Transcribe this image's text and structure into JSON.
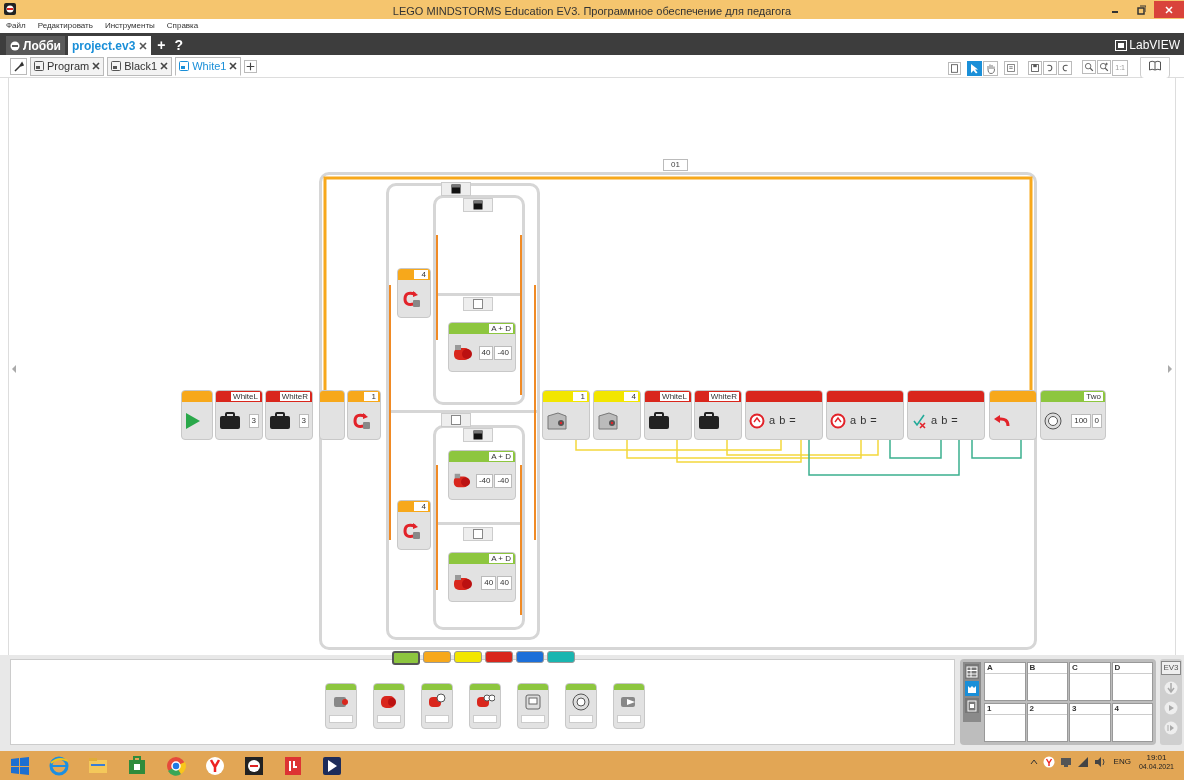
{
  "window": {
    "title": "LEGO MINDSTORMS Education EV3. Программное обеспечение для педагога"
  },
  "menu": [
    "Файл",
    "Редактировать",
    "Инструменты",
    "Справка"
  ],
  "project_tabs": [
    {
      "label": "Лобби",
      "selected": false
    },
    {
      "label": "project.ev3",
      "selected": true
    }
  ],
  "project_actions": [
    "+",
    "?"
  ],
  "brand": "LabVIEW",
  "program_tabs": [
    {
      "label": "Program",
      "selected": false
    },
    {
      "label": "Black1",
      "selected": false
    },
    {
      "label": "White1",
      "selected": true
    }
  ],
  "tools": [
    {
      "kind": "pointer",
      "selected": true
    },
    {
      "kind": "pan",
      "selected": false
    }
  ],
  "zoom_reset": "1:1",
  "loop": {
    "label": "01"
  },
  "main_blocks": [
    {
      "kind": "start",
      "color": "#f7a81b"
    },
    {
      "kind": "variable",
      "color": "#d9261c",
      "header": "WhiteL",
      "params": [
        "3"
      ]
    },
    {
      "kind": "variable",
      "color": "#d9261c",
      "header": "WhiteR",
      "params": [
        "3"
      ]
    },
    {
      "kind": "loop",
      "color": "#f7a81b"
    },
    {
      "kind": "switch",
      "color": "#f7a81b",
      "header": "1"
    },
    {
      "kind": "sensor",
      "color": "#f2e600",
      "header": "1"
    },
    {
      "kind": "sensor",
      "color": "#f2e600",
      "header": "4"
    },
    {
      "kind": "variable",
      "color": "#d9261c",
      "header": "WhiteL"
    },
    {
      "kind": "variable",
      "color": "#d9261c",
      "header": "WhiteR"
    },
    {
      "kind": "compare",
      "color": "#d9261c",
      "labels": [
        "a",
        "b",
        "="
      ]
    },
    {
      "kind": "compare",
      "color": "#d9261c",
      "labels": [
        "a",
        "b",
        "="
      ]
    },
    {
      "kind": "math",
      "color": "#d9261c",
      "labels": [
        "a",
        "b",
        "="
      ]
    },
    {
      "kind": "interrupt",
      "color": "#f7a81b"
    },
    {
      "kind": "sound",
      "color": "#8dc63f",
      "header": "Two",
      "params": [
        "100",
        "0"
      ]
    }
  ],
  "inner_blocks": [
    {
      "kind": "switch",
      "color": "#f7a81b",
      "header": "4"
    },
    {
      "kind": "motor",
      "color": "#8dc63f",
      "header": "A + D",
      "params": [
        "40",
        "-40"
      ]
    },
    {
      "kind": "switch",
      "color": "#f7a81b",
      "header": "4"
    },
    {
      "kind": "motor",
      "color": "#8dc63f",
      "header": "A + D",
      "params": [
        "-40",
        "-40"
      ]
    },
    {
      "kind": "motor",
      "color": "#8dc63f",
      "header": "A + D",
      "params": [
        "40",
        "40"
      ]
    }
  ],
  "palette_tabs": [
    {
      "color": "#8dc63f",
      "selected": true
    },
    {
      "color": "#f7a81b",
      "selected": false
    },
    {
      "color": "#f2e600",
      "selected": false
    },
    {
      "color": "#d9261c",
      "selected": false
    },
    {
      "color": "#1c6fd9",
      "selected": false
    },
    {
      "color": "#19b5b0",
      "selected": false
    }
  ],
  "palette_blocks": [
    {
      "kind": "medium-motor"
    },
    {
      "kind": "large-motor"
    },
    {
      "kind": "steering"
    },
    {
      "kind": "tank"
    },
    {
      "kind": "display"
    },
    {
      "kind": "sound"
    },
    {
      "kind": "light"
    }
  ],
  "port_view": {
    "tabs": [
      {
        "selected": false
      },
      {
        "selected": true
      },
      {
        "selected": false
      }
    ],
    "ports": [
      "A",
      "B",
      "C",
      "D",
      "1",
      "2",
      "3",
      "4"
    ]
  },
  "hardware": {
    "label": "EV3"
  },
  "tray": {
    "language": "ENG",
    "time": "19:01",
    "date": "04.04.2021"
  }
}
